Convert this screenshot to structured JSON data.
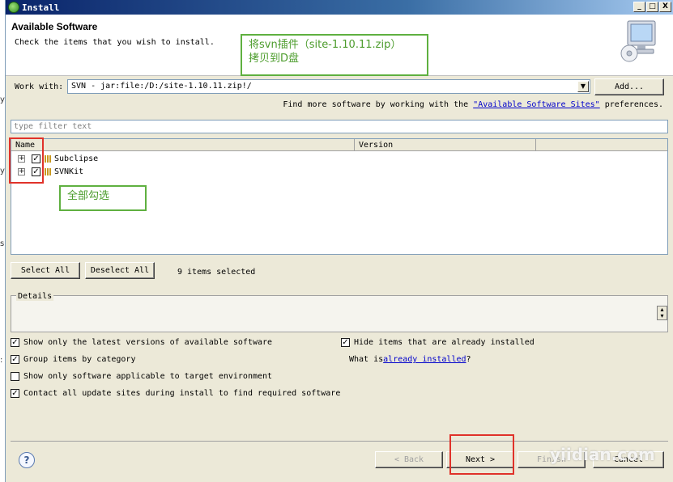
{
  "window": {
    "title": "Install"
  },
  "window_controls": {
    "minimize": "_",
    "maximize": "□",
    "close": "X"
  },
  "header": {
    "title": "Available Software",
    "description": "Check the items that you wish to install."
  },
  "annotations": {
    "callout_top": [
      "将svn插件（site-1.10.11.zip）",
      "拷贝到D盘"
    ],
    "callout_middle": "全部勾选"
  },
  "work_with": {
    "label": "Work with:",
    "value": "SVN - jar:file:/D:/site-1.10.11.zip!/",
    "add_label": "Add..."
  },
  "find_more": {
    "prefix": "Find more software by working with the ",
    "link": "\"Available Software Sites\"",
    "suffix": " preferences."
  },
  "filter": {
    "placeholder": "type filter text"
  },
  "tree": {
    "columns": [
      "Name",
      "Version"
    ],
    "rows": [
      {
        "label": "Subclipse",
        "checked": true
      },
      {
        "label": "SVNKit",
        "checked": true
      }
    ]
  },
  "selection": {
    "select_all": "Select All",
    "deselect_all": "Deselect All",
    "status": "9 items selected"
  },
  "details": {
    "label": "Details"
  },
  "options": {
    "latest_versions": {
      "label": "Show only the latest versions of available software",
      "checked": true
    },
    "group_by_category": {
      "label": "Group items by category",
      "checked": true
    },
    "target_env": {
      "label": "Show only software applicable to target environment",
      "checked": false
    },
    "contact_sites": {
      "label": "Contact all update sites during install to find required software",
      "checked": true
    },
    "hide_installed": {
      "label": "Hide items that are already installed",
      "checked": true
    },
    "already_installed": {
      "prefix": "What is ",
      "link": "already installed",
      "suffix": "?"
    }
  },
  "footer": {
    "help": "?",
    "back": "< Back",
    "next": "Next >",
    "finish": "Finish",
    "cancel": "Cancel"
  },
  "left_fragments": [
    "y",
    "y",
    "s",
    ":"
  ],
  "watermark": "yiidian.com",
  "colors": {
    "callout_border": "#5fb040",
    "highlight": "#e0322a",
    "link": "#0000cc"
  }
}
